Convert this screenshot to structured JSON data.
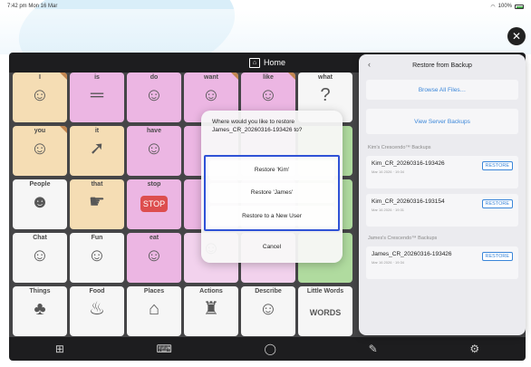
{
  "statusbar": {
    "time": "7:42 pm  Mon 16 Mar",
    "battery": "100%"
  },
  "app": {
    "title": "Home"
  },
  "grid": [
    {
      "label": "I",
      "icon": "☺",
      "color": "tan",
      "fold": true
    },
    {
      "label": "is",
      "icon": "═",
      "color": "pink",
      "fold": false
    },
    {
      "label": "do",
      "icon": "☺",
      "color": "pink",
      "fold": false
    },
    {
      "label": "want",
      "icon": "☺",
      "color": "pink",
      "fold": true
    },
    {
      "label": "like",
      "icon": "☺",
      "color": "pink",
      "fold": true
    },
    {
      "label": "what",
      "icon": "?",
      "color": "white",
      "fold": false
    },
    {
      "label": "you",
      "icon": "☺",
      "color": "tan",
      "fold": true
    },
    {
      "label": "it",
      "icon": "➚",
      "color": "tan",
      "fold": false
    },
    {
      "label": "have",
      "icon": "☺",
      "color": "pink",
      "fold": false
    },
    {
      "label": "",
      "icon": "",
      "color": "pink",
      "fold": false
    },
    {
      "label": "",
      "icon": "",
      "color": "pink",
      "fold": false
    },
    {
      "label": "",
      "icon": "",
      "color": "green",
      "fold": false
    },
    {
      "label": "People",
      "icon": "☻",
      "color": "white",
      "fold": false
    },
    {
      "label": "that",
      "icon": "☛",
      "color": "tan",
      "fold": false
    },
    {
      "label": "stop",
      "icon": "STOP",
      "color": "pink",
      "fold": false
    },
    {
      "label": "",
      "icon": "",
      "color": "pink",
      "fold": false
    },
    {
      "label": "",
      "icon": "",
      "color": "pink",
      "fold": false
    },
    {
      "label": "",
      "icon": "",
      "color": "green",
      "fold": false
    },
    {
      "label": "Chat",
      "icon": "☺",
      "color": "white",
      "fold": false
    },
    {
      "label": "Fun",
      "icon": "☺",
      "color": "white",
      "fold": false
    },
    {
      "label": "eat",
      "icon": "☺",
      "color": "pink",
      "fold": false
    },
    {
      "label": "",
      "icon": "☺",
      "color": "lightpink",
      "fold": false
    },
    {
      "label": "",
      "icon": "",
      "color": "lightpink",
      "fold": false
    },
    {
      "label": "",
      "icon": "",
      "color": "green",
      "fold": false
    },
    {
      "label": "Things",
      "icon": "♣",
      "color": "white",
      "fold": false
    },
    {
      "label": "Food",
      "icon": "♨",
      "color": "white",
      "fold": false
    },
    {
      "label": "Places",
      "icon": "⌂",
      "color": "white",
      "fold": false
    },
    {
      "label": "Actions",
      "icon": "♜",
      "color": "white",
      "fold": false
    },
    {
      "label": "Describe",
      "icon": "☺",
      "color": "white",
      "fold": false
    },
    {
      "label": "Little Words",
      "icon": "WORDS",
      "color": "white",
      "fold": false
    }
  ],
  "panel": {
    "title": "Restore from Backup",
    "browse_label": "Browse All Files…",
    "view_server_label": "View Server Backups",
    "section1": "Kim's Crescendo™ Backups",
    "section2": "James's Crescendo™ Backups",
    "items": [
      {
        "name": "Kim_CR_20260316-193426",
        "sub": "Mar 16 2026 · 19:34",
        "action": "RESTORE"
      },
      {
        "name": "Kim_CR_20260316-193154",
        "sub": "Mar 16 2026 · 19:31",
        "action": "RESTORE"
      },
      {
        "name": "James_CR_20260316-193426",
        "sub": "Mar 16 2026 · 19:34",
        "action": "RESTORE"
      }
    ]
  },
  "dialog": {
    "message": "Where would you like to restore James_CR_20260316-193426 to?",
    "options": [
      "Restore 'Kim'",
      "Restore 'James'",
      "Restore to a New User"
    ],
    "cancel": "Cancel"
  },
  "colors": {
    "tan": "#f3d6a4",
    "pink": "#e8a6dd",
    "white": "#f4f4f4",
    "green": "#9fd48a",
    "lightpink": "#f0c9ea",
    "highlight": "#2f52d6",
    "link": "#3a86d9"
  },
  "toolbar_icons": [
    "grid-icon",
    "keyboard-icon",
    "chat-icon",
    "pencil-icon",
    "gear-icon"
  ]
}
